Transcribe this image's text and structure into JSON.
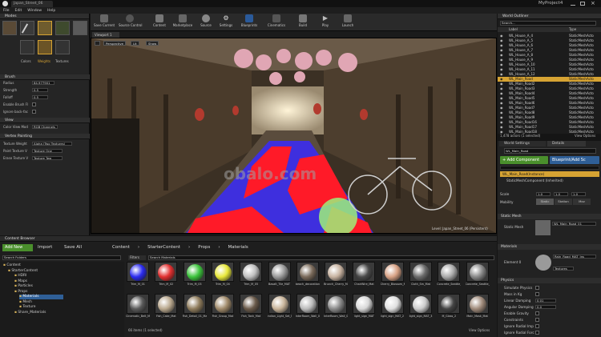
{
  "window": {
    "title": "Japan_Street_06",
    "project": "MyProject4"
  },
  "menu": [
    "File",
    "Edit",
    "Window",
    "Help"
  ],
  "modes": {
    "tab": "Modes",
    "tiles": [
      "Colors",
      "Weights",
      "Textures"
    ],
    "brush": {
      "header": "Brush",
      "radius_label": "Radius",
      "radius": "64.977901",
      "strength_label": "Strength",
      "strength": "0.5",
      "falloff_label": "Falloff",
      "falloff": "0.5",
      "enable_brush_label": "Enable Brush Fl",
      "ignore_backface_label": "Ignore back-fac"
    },
    "view": {
      "header": "View",
      "color_view_label": "Color View Mod",
      "color_view": "RGB Channels"
    },
    "vertex": {
      "header": "Vertex Painting",
      "texture_weight_label": "Texture Weight",
      "texture_weight": "Alpha (Two Textures)",
      "paint_texture_label": "Paint Texture V",
      "paint_texture": "Texture One",
      "erase_texture_label": "Erase Texture V",
      "erase_texture": "Texture Two"
    }
  },
  "toolbar": [
    {
      "label": "Save Current",
      "icon": "save-icon"
    },
    {
      "label": "Source Control",
      "icon": "source-control-icon"
    },
    {
      "label": "Content",
      "icon": "content-icon"
    },
    {
      "label": "Marketplace",
      "icon": "marketplace-icon"
    },
    {
      "label": "Source",
      "icon": "source-icon"
    },
    {
      "label": "Settings",
      "icon": "gear-icon"
    },
    {
      "label": "Blueprints",
      "icon": "blueprint-icon"
    },
    {
      "label": "Cinematics",
      "icon": "cinematics-icon"
    },
    {
      "label": "Build",
      "icon": "build-icon"
    },
    {
      "label": "Play",
      "icon": "play-icon"
    },
    {
      "label": "Launch",
      "icon": "launch-icon"
    }
  ],
  "viewport": {
    "tab": "Viewport 1",
    "perspective": "Perspective",
    "lit": "Lit",
    "show": "Show",
    "level": "Level:  Japan_Street_06 (Persistent)",
    "watermark": "obalo.com"
  },
  "outliner": {
    "tab": "World Outliner",
    "search_placeholder": "Search...",
    "col_label": "Label",
    "col_type": "Type",
    "rows": [
      {
        "label": "WL_House_A_4",
        "type": "StaticMeshActo"
      },
      {
        "label": "WL_House_A_5",
        "type": "StaticMeshActo"
      },
      {
        "label": "WL_House_A_6",
        "type": "StaticMeshActo"
      },
      {
        "label": "WL_House_A_7",
        "type": "StaticMeshActo"
      },
      {
        "label": "WL_House_A_8",
        "type": "StaticMeshActo"
      },
      {
        "label": "WL_House_A_9",
        "type": "StaticMeshActo"
      },
      {
        "label": "WL_House_A_10",
        "type": "StaticMeshActo"
      },
      {
        "label": "WL_House_A_11",
        "type": "StaticMeshActo"
      },
      {
        "label": "WL_House_A_12",
        "type": "StaticMeshActo"
      },
      {
        "label": "WL_Main_Road",
        "type": "StaticMeshActo"
      },
      {
        "label": "WL_Main_Road2",
        "type": "StaticMeshActo"
      },
      {
        "label": "WL_Main_Road3",
        "type": "StaticMeshActo"
      },
      {
        "label": "WL_Main_Road4",
        "type": "StaticMeshActo"
      },
      {
        "label": "WL_Main_Road5",
        "type": "StaticMeshActo"
      },
      {
        "label": "WL_Main_Road6",
        "type": "StaticMeshActo"
      },
      {
        "label": "WL_Main_Road7",
        "type": "StaticMeshActo"
      },
      {
        "label": "WL_Main_Road8",
        "type": "StaticMeshActo"
      },
      {
        "label": "WL_Main_Road9",
        "type": "StaticMeshActo"
      },
      {
        "label": "WL_Main_Road16",
        "type": "StaticMeshActo"
      },
      {
        "label": "WL_Main_Road17",
        "type": "StaticMeshActo"
      },
      {
        "label": "WL_Main_Road18",
        "type": "StaticMeshActo"
      }
    ],
    "status": "1,478 actors (1 selected)",
    "view_options": "View Options"
  },
  "details": {
    "tabs": [
      "World Settings",
      "Details"
    ],
    "name": "WL_Main_Road",
    "add_component": "+ Add Component",
    "blueprint": "Blueprint/Add Sc",
    "instance": "WL_Main_Road(Instance)",
    "component": "StaticMeshComponent (Inherited)",
    "scale_label": "Scale",
    "scale": [
      "1.0",
      "1.0",
      "1.0"
    ],
    "mobility_label": "Mobility",
    "mobility": [
      "Static",
      "Station",
      "Mov"
    ],
    "static_mesh_header": "Static Mesh",
    "static_mesh_label": "Static Mesh",
    "static_mesh_value": "WL_Main_Road_01",
    "materials_header": "Materials",
    "element_label": "Element 0",
    "element_value": "Rain_Road_MAT_Ins",
    "element_sub": "Textures",
    "physics_header": "Physics",
    "physics": [
      {
        "label": "Simulate Physics",
        "value": ""
      },
      {
        "label": "Mass in Kg",
        "value": ""
      },
      {
        "label": "Linear Damping",
        "value": "0.01"
      },
      {
        "label": "Angular Damping",
        "value": "0.0"
      },
      {
        "label": "Enable Gravity",
        "value": ""
      },
      {
        "label": "Constraints",
        "value": ""
      },
      {
        "label": "Ignore Radial Imp",
        "value": ""
      },
      {
        "label": "Ignore Radial Forc",
        "value": ""
      }
    ]
  },
  "content_browser": {
    "tab": "Content Browser",
    "add_new": "Add New",
    "import": "Import",
    "save_all": "Save All",
    "breadcrumb": [
      "Content",
      "StarterContent",
      "Props",
      "Materials"
    ],
    "search_folders": "Search Folders",
    "filters": "Filters",
    "search_materials": "Search Materials",
    "tree": [
      "Content",
      "StarterContent",
      "HDRI",
      "Maps",
      "Particles",
      "Props",
      "Materials",
      "Mesh",
      "Texture",
      "Share_Materials"
    ],
    "assets_row1": [
      "Trim_M_01",
      "Trim_M_02",
      "Trim_M_03",
      "Trim_M_04",
      "Trim_M_05",
      "Basalt_Tile_MAT",
      "beach_decoration_MAT",
      "Brunch_Cherry_MAT",
      "ChairWire_Mat",
      "Cherry_Blossom_MAT",
      "Cloth_Sm_Mat",
      "Concrete_Seattle_Parking_MAT",
      "Concrete_Seattle_Parking_MAT_2"
    ],
    "assets_row2": [
      "Cinematic_Belt_Mat",
      "Fish_Cake_Mat",
      "Fish_Detail_01_Mat",
      "Fish_Group_Mat",
      "Fish_Tank_Mat",
      "Indian_Light_Set_Mat",
      "InterRoom_Wall_01_Mat",
      "InterRoom_Wall_02_Mat_1",
      "light_sign_MAT",
      "light_sign_MAT_2",
      "light_sign_MAT_3",
      "M_Glass_2",
      "Main_Mask_Mat"
    ],
    "status": "66 items (1 selected)",
    "view_options": "View Options"
  },
  "colors": {
    "accent": "#d6a333",
    "add_green": "#4a8f2c",
    "select_blue": "#2f5f97",
    "paint_blue": "#3b2cf0",
    "paint_red": "#ff1a28"
  }
}
